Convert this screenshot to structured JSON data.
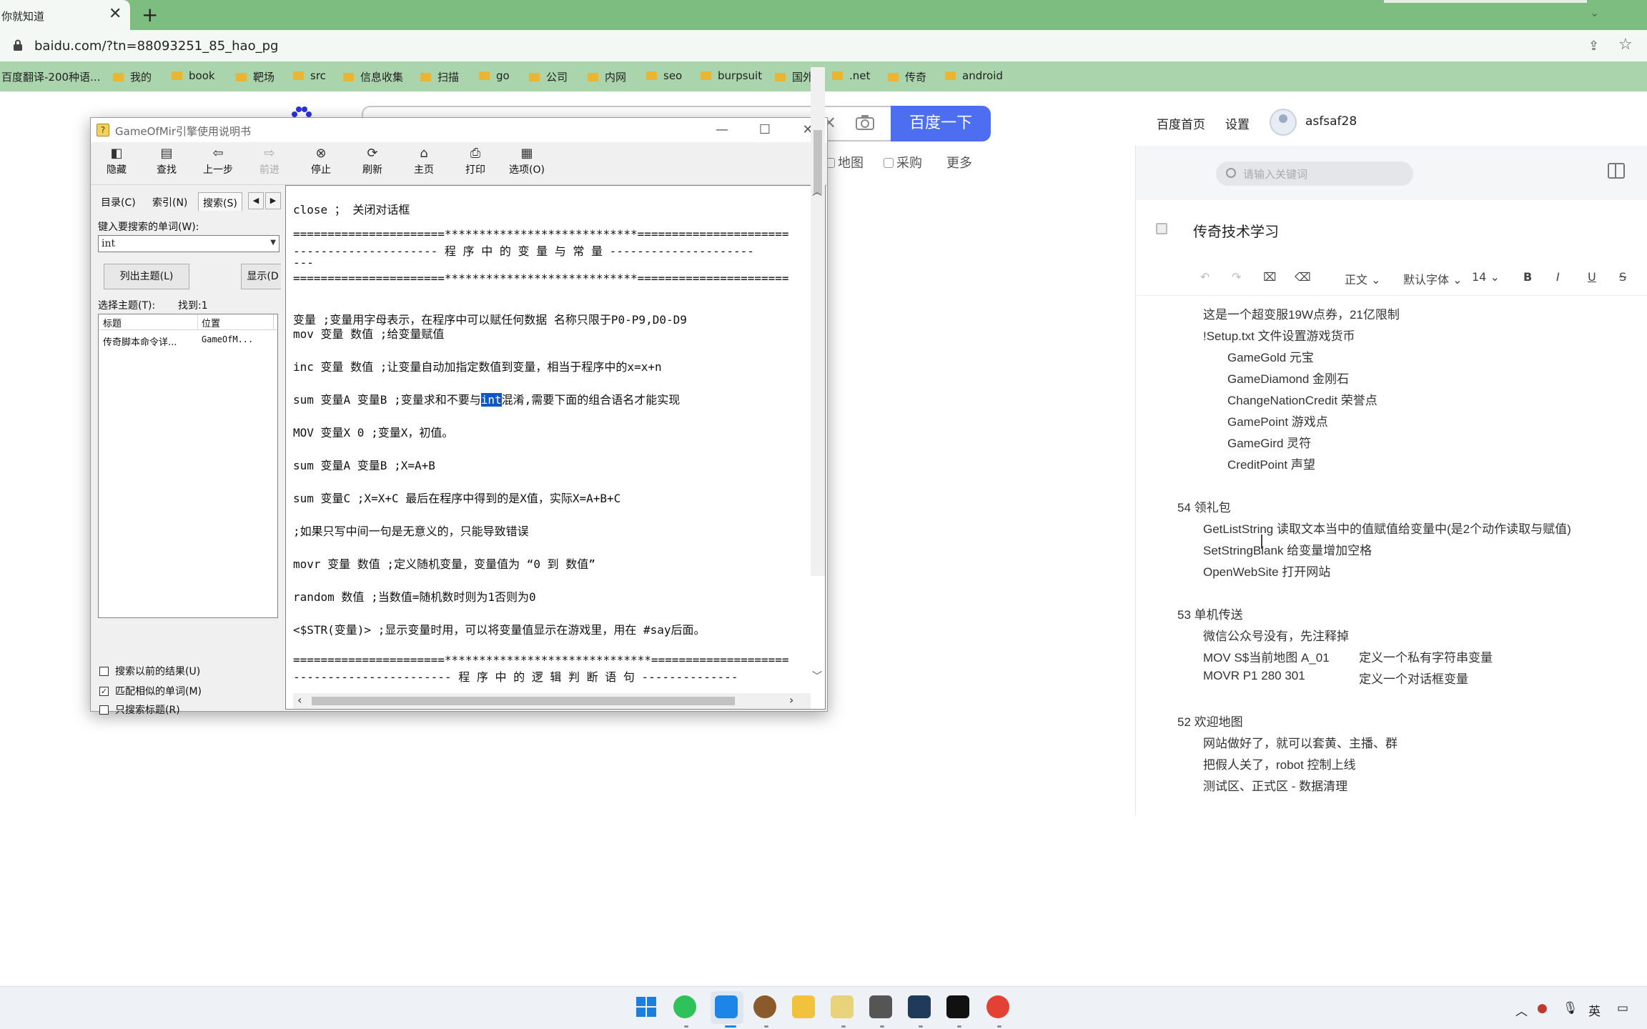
{
  "browser": {
    "tab_title": "你就知道",
    "tab_close": "✕",
    "new_tab": "+",
    "tab_menu": "⌄",
    "url": "baidu.com/?tn=88093251_85_hao_pg",
    "bookmarks": [
      "百度翻译-200种语...",
      "我的",
      "book",
      "靶场",
      "src",
      "信息收集",
      "扫描",
      "go",
      "公司",
      "内网",
      "seo",
      "burpsuit",
      "国外",
      ".net",
      "传奇",
      "android"
    ]
  },
  "baidu": {
    "search_button": "百度一下",
    "nav": [
      "地图",
      "采购",
      "更多"
    ],
    "home_link": "百度首页",
    "settings_link": "设置",
    "username": "asfsaf28"
  },
  "note": {
    "search_placeholder": "请输入关键词",
    "title": "传奇技术学习",
    "toolbar": {
      "style": "正文",
      "font": "默认字体",
      "size": "14",
      "bold": "B",
      "italic": "I",
      "underline": "U",
      "strike": "S"
    },
    "lines": {
      "l01": "这是一个超变服19W点券，21亿限制",
      "l02": "!Setup.txt  文件设置游戏货币",
      "l03": "GameGold 元宝",
      "l04": "GameDiamond  金刚石",
      "l05": "ChangeNationCredit  荣誉点",
      "l06": "GamePoint  游戏点",
      "l07": "GameGird  灵符",
      "l08": "CreditPoint 声望",
      "l09": "54 领礼包",
      "l10": "GetListString 读取文本当中的值赋值给变量中(是2个动作读取与赋值)",
      "l11": "SetStringBlank  给变量增加空格",
      "l12": "OpenWebSite 打开网站",
      "l13": "53  单机传送",
      "l14": "微信公众号没有，先注释掉",
      "l15": "MOV S$当前地图 A_01",
      "l15b": "定义一个私有字符串变量",
      "l16": "MOVR P1 280 301",
      "l16b": "定义一个对话框变量",
      "l17": "52  欢迎地图",
      "l18": "网站做好了，就可以套黄、主播、群",
      "l19": "把假人关了，robot 控制上线",
      "l20": "测试区、正式区 - 数据清理"
    }
  },
  "help": {
    "title": "GameOfMir引擎使用说明书",
    "toolbar": [
      "隐藏",
      "查找",
      "上一步",
      "前进",
      "停止",
      "刷新",
      "主页",
      "打印",
      "选项(O)"
    ],
    "tabs": [
      "目录(C)",
      "索引(N)",
      "搜索(S)"
    ],
    "search_label": "键入要搜索的单词(W):",
    "search_value": "int",
    "list_topics_button": "列出主题(L)",
    "display_button": "显示(D",
    "select_topic_label": "选择主题(T):",
    "found_label": "找到:1",
    "col_title": "标题",
    "col_location": "位置",
    "result_title": "传奇脚本命令详...",
    "result_location": "GameOfM...",
    "options": [
      {
        "label": "搜索以前的结果(U)",
        "checked": false
      },
      {
        "label": "匹配相似的单词(M)",
        "checked": true
      },
      {
        "label": "只搜索标题(R)",
        "checked": false
      }
    ],
    "content": {
      "c01": "close ； 关闭对话框",
      "c02": "======================****************************======================",
      "c03": "--------------------- 程 序 中 的 变 量 与 常 量 ---------------------",
      "c04": "---",
      "c05": "======================****************************======================",
      "c06": "变量 ;变量用字母表示，在程序中可以赋任何数据 名称只限于P0-P9,D0-D9",
      "c07": "mov 变量 数值 ;给变量赋值",
      "c08": "inc 变量 数值 ;让变量自动加指定数值到变量，相当于程序中的x=x+n",
      "c09a": "sum 变量A 变量B ;变量求和不要与",
      "c09hl": "int",
      "c09b": "混淆,需要下面的组合语名才能实现",
      "c10": "MOV 变量X 0 ;变量X，初值。",
      "c11": "sum 变量A 变量B ;X=A+B",
      "c12": "sum 变量C ;X=X+C 最后在程序中得到的是X值，实际X=A+B+C",
      "c13": ";如果只写中间一句是无意义的，只能导致错误",
      "c14": "movr 变量 数值 ;定义随机变量，变量值为 “0 到 数值”",
      "c15": "random 数值 ;当数值=随机数时则为1否则为0",
      "c16": "<$STR(变量)> ;显示变量时用，可以将变量值显示在游戏里，用在 #say后面。",
      "c17": "======================******************************====================",
      "c18": "----------------------- 程 序 中 的 逻 辑 判 断 语 句 --------------"
    }
  },
  "taskbar": {
    "lang": "英"
  }
}
